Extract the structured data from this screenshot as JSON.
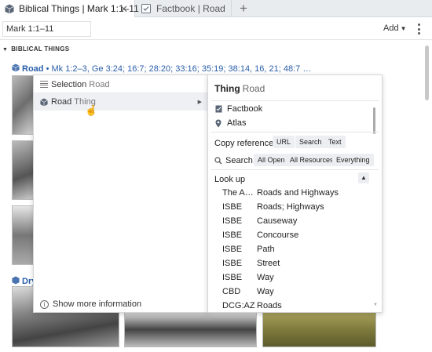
{
  "tabs": [
    {
      "label": "Biblical Things | Mark 1:1–11",
      "active": true,
      "icon": "cube-icon"
    },
    {
      "label": "Factbook | Road",
      "active": false,
      "icon": "factbook-icon"
    }
  ],
  "new_tab_label": "+",
  "toolbar": {
    "reference_value": "Mark 1:1–11",
    "add_label": "Add"
  },
  "section": {
    "title": "BIBLICAL THINGS"
  },
  "road_entry": {
    "title": "Road",
    "bullet": "•",
    "refs": "Mk 1:2–3, Ge 3:24; 16:7; 28:20; 33:16; 35:19; 38:14, 16, 21; 48:7 …"
  },
  "dry_entry": {
    "title": "Dry"
  },
  "context_menu": {
    "selection_label": "Selection",
    "selection_value": "Road",
    "road_label": "Road",
    "road_kind": "Thing",
    "show_more_label": "Show more information"
  },
  "thing_panel": {
    "title": "Thing",
    "subtitle": "Road",
    "links": [
      {
        "label": "Factbook",
        "icon": "factbook-icon"
      },
      {
        "label": "Atlas",
        "icon": "map-pin-icon"
      }
    ],
    "copy_reference_label": "Copy reference:",
    "copy_chips": [
      "URL",
      "Search",
      "Text"
    ],
    "search_label": "Search:",
    "search_chips": [
      "All Open",
      "All Resources",
      "Everything"
    ],
    "lookup_label": "Look up",
    "lookup_rows": [
      {
        "source": "The A…",
        "term": "Roads and Highways"
      },
      {
        "source": "ISBE",
        "term": "Roads; Highways"
      },
      {
        "source": "ISBE",
        "term": "Causeway"
      },
      {
        "source": "ISBE",
        "term": "Concourse"
      },
      {
        "source": "ISBE",
        "term": "Path"
      },
      {
        "source": "ISBE",
        "term": "Street"
      },
      {
        "source": "ISBE",
        "term": "Way"
      },
      {
        "source": "CBD",
        "term": "Way"
      },
      {
        "source": "DCG:AZ",
        "term": "Roads"
      }
    ]
  },
  "colors": {
    "link_blue": "#2a5ea8",
    "tab_bar": "#e9ecef",
    "chip_bg": "#eceef1"
  }
}
